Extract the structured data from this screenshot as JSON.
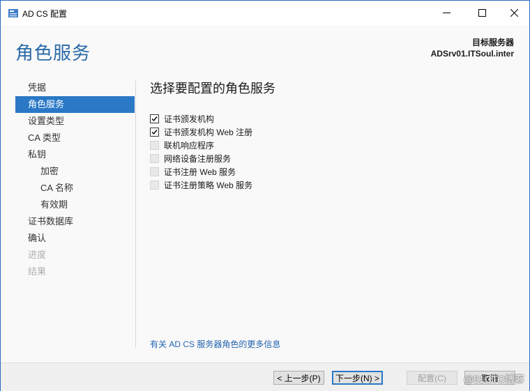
{
  "window": {
    "title": "AD CS 配置"
  },
  "header": {
    "page_title": "角色服务",
    "target_label": "目标服务器",
    "target_value": "ADSrv01.ITSoul.inter"
  },
  "nav": {
    "items": [
      {
        "label": "凭据"
      },
      {
        "label": "角色服务"
      },
      {
        "label": "设置类型"
      },
      {
        "label": "CA 类型"
      },
      {
        "label": "私钥"
      },
      {
        "label": "加密"
      },
      {
        "label": "CA 名称"
      },
      {
        "label": "有效期"
      },
      {
        "label": "证书数据库"
      },
      {
        "label": "确认"
      },
      {
        "label": "进度"
      },
      {
        "label": "结果"
      }
    ]
  },
  "main": {
    "section_title": "选择要配置的角色服务",
    "roles": [
      {
        "label": "证书颁发机构",
        "checked": true
      },
      {
        "label": "证书颁发机构 Web 注册",
        "checked": true
      },
      {
        "label": "联机响应程序",
        "checked": false
      },
      {
        "label": "网络设备注册服务",
        "checked": false
      },
      {
        "label": "证书注册 Web 服务",
        "checked": false
      },
      {
        "label": "证书注册策略 Web 服务",
        "checked": false
      }
    ],
    "more_info_link": "有关 AD CS 服务器角色的更多信息"
  },
  "footer": {
    "prev_label": "< 上一步(P)",
    "next_label": "下一步(N) >",
    "configure_label": "配置(C)",
    "cancel_label": "取消"
  },
  "watermark": "@51CTO博客",
  "colors": {
    "accent": "#2a78c6",
    "title_blue": "#2a6aa8",
    "link": "#2464b0"
  }
}
